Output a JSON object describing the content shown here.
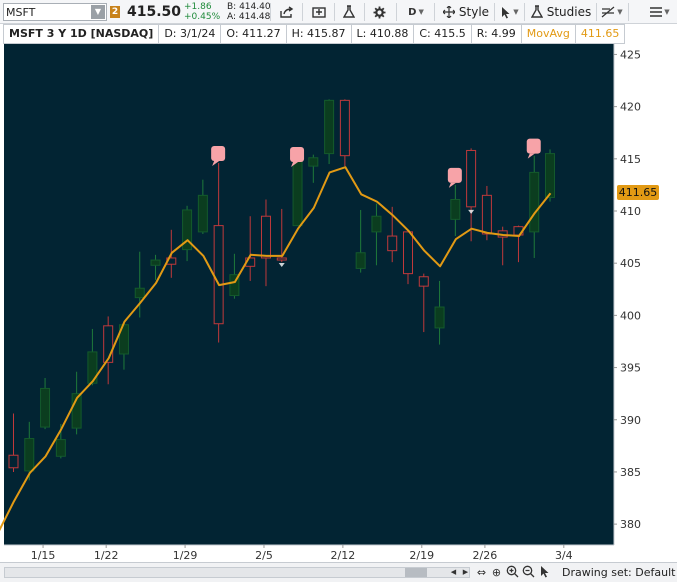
{
  "toolbar": {
    "symbol": "MSFT",
    "link_number": "2",
    "last_price": "415.50",
    "change_abs": "+1.86",
    "change_pct": "+0.45%",
    "bid": "B: 414.40",
    "ask": "A: 414.48",
    "period_label": "D",
    "style_label": "Style",
    "studies_label": "Studies"
  },
  "info_bar": {
    "title": "MSFT 3 Y 1D [NASDAQ]",
    "date": "D: 3/1/24",
    "open": "O: 411.27",
    "high": "H: 415.87",
    "low": "L: 410.88",
    "close": "C: 415.5",
    "range": "R: 4.99",
    "ma_label": "MovAvg",
    "ma_value": "411.65"
  },
  "status_bar": {
    "drawing_set": "Drawing set: Default"
  },
  "colors": {
    "background": "#022433",
    "up": "#0b3d1f",
    "up_wick": "#1f7a3a",
    "down": "#c0393b",
    "ma": "#e29a14",
    "axis_text": "#333333",
    "note_bubble": "#f7a3a8"
  },
  "chart_data": {
    "type": "candlestick",
    "y_axis": {
      "min": 378,
      "max": 426,
      "ticks": [
        380,
        385,
        390,
        395,
        400,
        405,
        410,
        415,
        420,
        425
      ]
    },
    "x_labels": [
      {
        "label": "1/15",
        "index": 2
      },
      {
        "label": "1/22",
        "index": 6
      },
      {
        "label": "1/29",
        "index": 11
      },
      {
        "label": "2/5",
        "index": 16
      },
      {
        "label": "2/12",
        "index": 21
      },
      {
        "label": "2/19",
        "index": 26
      },
      {
        "label": "2/26",
        "index": 30
      },
      {
        "label": "3/4",
        "index": 35
      }
    ],
    "ohlc": [
      [
        386.6,
        390.6,
        385.0,
        385.4
      ],
      [
        385.1,
        389.8,
        384.2,
        388.2
      ],
      [
        389.3,
        394.0,
        389.1,
        393.0
      ],
      [
        386.5,
        389.6,
        386.3,
        388.1
      ],
      [
        389.2,
        394.6,
        388.6,
        392.5
      ],
      [
        393.5,
        398.7,
        393.3,
        396.5
      ],
      [
        399.0,
        399.9,
        393.4,
        395.5
      ],
      [
        396.3,
        398.0,
        394.8,
        399.1
      ],
      [
        401.7,
        406.1,
        399.8,
        402.6
      ],
      [
        404.8,
        405.8,
        403.4,
        405.3
      ],
      [
        405.5,
        408.2,
        403.6,
        404.9
      ],
      [
        406.3,
        410.5,
        405.2,
        410.1
      ],
      [
        408.0,
        413.0,
        407.8,
        411.5
      ],
      [
        408.6,
        414.6,
        397.4,
        399.2
      ],
      [
        401.9,
        405.9,
        401.6,
        403.9
      ],
      [
        405.5,
        409.5,
        403.3,
        404.7
      ],
      [
        409.5,
        411.1,
        402.8,
        405.5
      ],
      [
        405.5,
        410.2,
        405.1,
        405.3
      ],
      [
        408.6,
        414.5,
        408.6,
        415.3
      ],
      [
        414.3,
        415.4,
        412.7,
        415.1
      ],
      [
        415.5,
        420.7,
        414.5,
        420.6
      ],
      [
        420.6,
        420.7,
        414.3,
        415.3
      ],
      [
        404.5,
        410.1,
        404.1,
        406.0
      ],
      [
        408.0,
        410.7,
        404.8,
        409.5
      ],
      [
        407.6,
        410.4,
        405.1,
        406.2
      ],
      [
        408.0,
        408.0,
        403.0,
        404.0
      ],
      [
        403.7,
        404.0,
        398.4,
        402.8
      ],
      [
        398.8,
        403.3,
        397.2,
        400.8
      ],
      [
        409.2,
        412.5,
        407.6,
        411.1
      ],
      [
        415.8,
        416.0,
        407.1,
        410.4
      ],
      [
        411.5,
        412.4,
        407.2,
        407.8
      ],
      [
        408.1,
        408.5,
        404.8,
        407.5
      ],
      [
        408.5,
        408.6,
        405.1,
        407.7
      ],
      [
        408.0,
        415.3,
        405.5,
        413.7
      ],
      [
        411.3,
        415.9,
        410.9,
        415.5
      ]
    ],
    "moving_average": [
      379.2,
      382.2,
      384.9,
      386.5,
      389.1,
      392.1,
      393.7,
      395.9,
      399.4,
      401.2,
      403.1,
      406.0,
      407.2,
      405.7,
      402.9,
      403.2,
      405.8,
      405.7,
      405.7,
      408.3,
      410.3,
      413.7,
      414.2,
      411.6,
      410.9,
      409.6,
      408.1,
      406.2,
      404.7,
      407.3,
      408.3,
      407.9,
      407.7,
      407.6,
      409.8,
      411.7
    ],
    "ma_label_value": 411.65,
    "notes": [
      13,
      18,
      28,
      33
    ],
    "dated_candles": [
      17,
      29
    ],
    "index_map_note": "index 0 = first visible candle; MA has one extra point at chart left edge"
  }
}
